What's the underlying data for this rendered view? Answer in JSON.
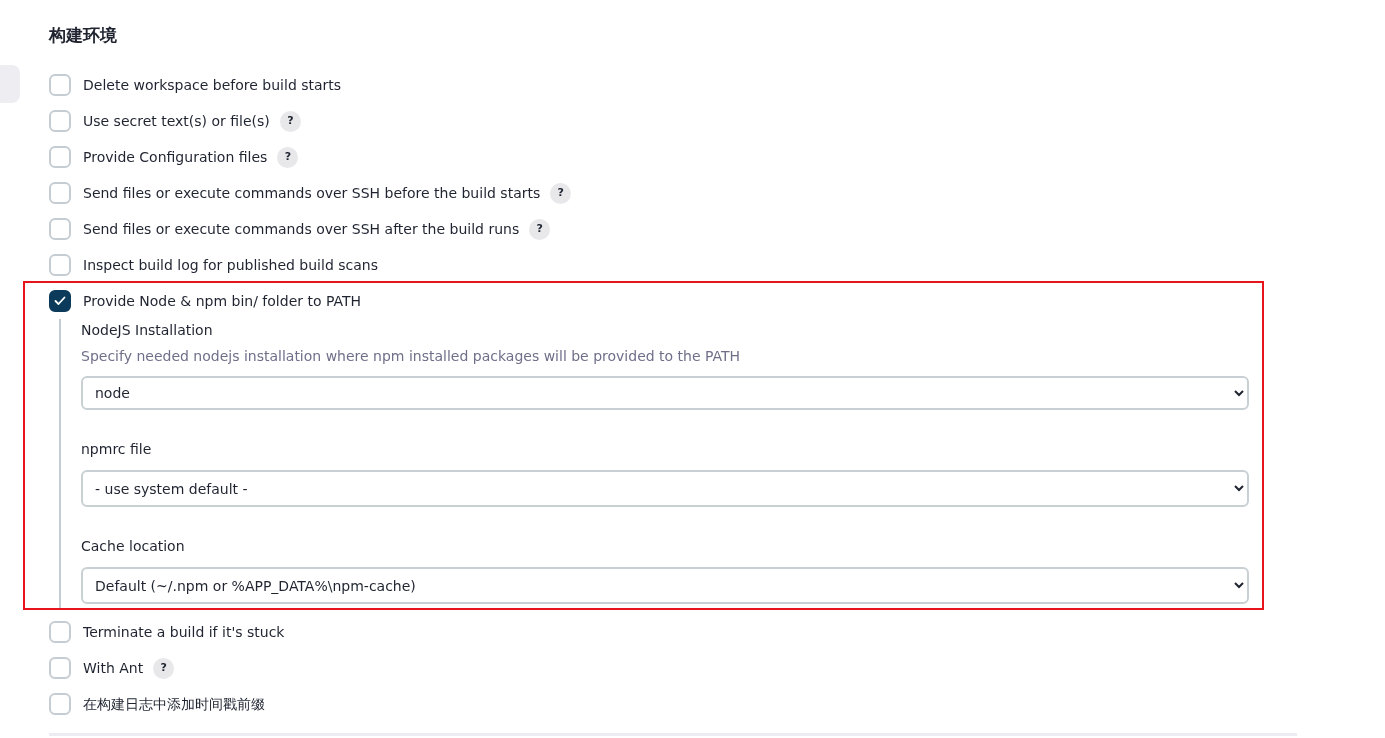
{
  "section": {
    "title": "构建环境"
  },
  "options": [
    {
      "label": "Delete workspace before build starts",
      "checked": false,
      "highlighted": false
    },
    {
      "label": "Use secret text(s) or file(s)",
      "help": "?",
      "checked": false,
      "highlighted": false
    },
    {
      "label": "Provide Configuration files",
      "help": "?",
      "checked": false,
      "highlighted": false
    },
    {
      "label": "Send files or execute commands over SSH before the build starts",
      "help": "?",
      "checked": false,
      "highlighted": false
    },
    {
      "label": "Send files or execute commands over SSH after the build runs",
      "help": "?",
      "checked": false,
      "highlighted": false
    },
    {
      "label": "Inspect build log for published build scans",
      "checked": false,
      "highlighted": false
    },
    {
      "label": "Provide Node & npm bin/ folder to PATH",
      "checked": true,
      "highlighted": true,
      "fields": [
        {
          "label": "NodeJS Installation",
          "description": "Specify needed nodejs installation where npm installed packages will be provided to the PATH",
          "value": "node"
        },
        {
          "label": "npmrc file",
          "value": "- use system default -"
        },
        {
          "label": "Cache location",
          "value": "Default (~/.npm or %APP_DATA%\\npm-cache)"
        }
      ]
    },
    {
      "label": "Terminate a build if it's stuck",
      "checked": false,
      "highlighted": false
    },
    {
      "label": "With Ant",
      "help": "?",
      "checked": false,
      "highlighted": false
    },
    {
      "label": "在构建日志中添加时间戳前缀",
      "checked": false,
      "highlighted": false
    }
  ]
}
